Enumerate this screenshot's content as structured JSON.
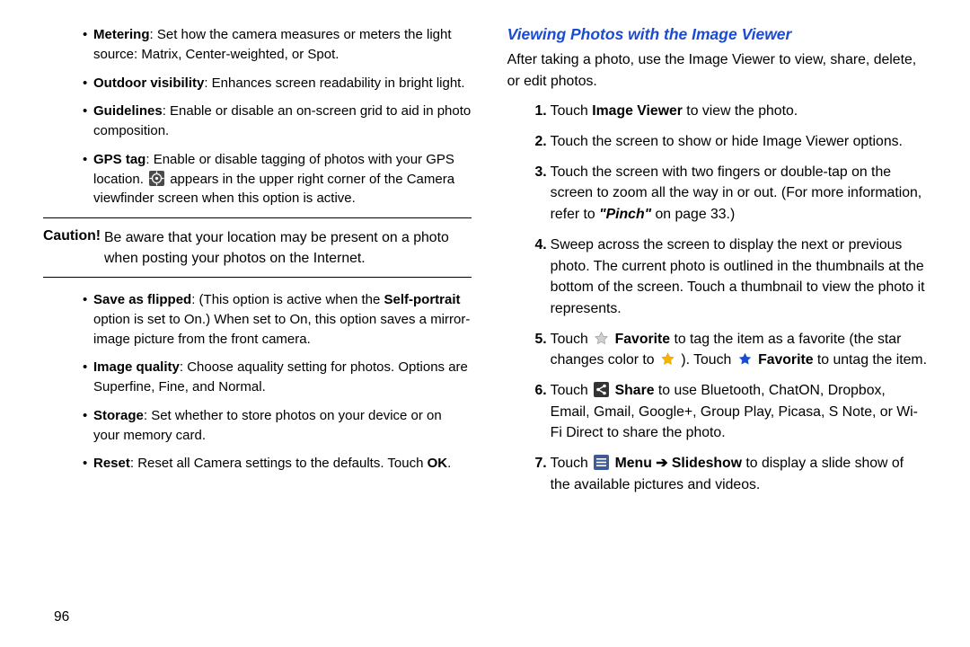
{
  "left": {
    "bullets_a": [
      {
        "term": "Metering",
        "desc": ": Set how the camera measures or meters the light source: Matrix, Center-weighted, or Spot."
      },
      {
        "term": "Outdoor visibility",
        "desc": ": Enhances screen readability in bright light."
      },
      {
        "term": "Guidelines",
        "desc": ": Enable or disable an on-screen grid to aid in photo composition."
      },
      {
        "term": "GPS tag",
        "desc_before": ": Enable or disable tagging of photos with your GPS location. ",
        "desc_after": " appears in the upper right corner of the Camera viewfinder screen when this option is active."
      }
    ],
    "caution_label": "Caution!",
    "caution_body": "Be aware that your location may be present on a photo when posting your photos on the Internet.",
    "bullets_b": [
      {
        "term": "Save as flipped",
        "desc_before": ": (This option is active when the ",
        "strong": "Self-portrait",
        "desc_after": " option is set to On.) When set to On, this option saves a mirror-image picture from the front camera."
      },
      {
        "term": "Image quality",
        "desc": ": Choose aquality setting for photos. Options are Superfine, Fine, and Normal."
      },
      {
        "term": "Storage",
        "desc": ": Set whether to store photos on your device or on your memory card."
      },
      {
        "term": "Reset",
        "desc_before": ": Reset all Camera settings to the defaults. Touch ",
        "strong": "OK",
        "desc_after": "."
      }
    ]
  },
  "right": {
    "heading": "Viewing Photos with the Image Viewer",
    "intro": "After taking a photo, use the Image Viewer to view, share, delete, or edit photos.",
    "steps": {
      "s1_a": "Touch ",
      "s1_b": "Image Viewer",
      "s1_c": " to view the photo.",
      "s2": "Touch the screen to show or hide Image Viewer options.",
      "s3_a": "Touch the screen with two fingers or double-tap on the screen to zoom all the way in or out. (For more information, refer to ",
      "s3_b": "\"Pinch\"",
      "s3_c": " on page 33.)",
      "s4": "Sweep across the screen to display the next or previous photo. The current photo is outlined in the thumbnails at the bottom of the screen. Touch a thumbnail to view the photo it represents.",
      "s5_a": "Touch ",
      "s5_fav1": "Favorite",
      "s5_b": " to tag the item as a favorite (the star changes color to ",
      "s5_c": " ). Touch ",
      "s5_fav2": "Favorite",
      "s5_d": " to untag the item.",
      "s6_a": "Touch ",
      "s6_share": "Share",
      "s6_b": " to use Bluetooth, ChatON, Dropbox, Email, Gmail, Google+, Group Play, Picasa, S Note, or Wi-Fi Direct to share the photo.",
      "s7_a": "Touch ",
      "s7_menu": "Menu ➔ Slideshow",
      "s7_b": " to display a slide show of the available pictures and videos."
    }
  },
  "page_number": "96"
}
